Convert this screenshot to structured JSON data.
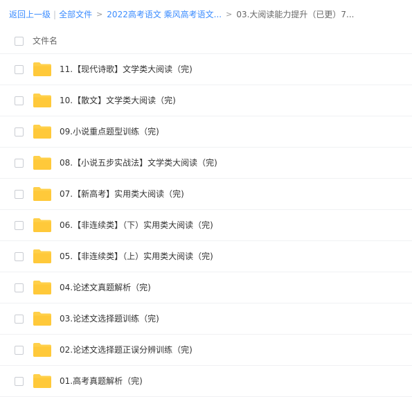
{
  "breadcrumb": {
    "back": "返回上一级",
    "all_files": "全部文件",
    "parent": "2022高考语文 乘风高考语文...",
    "current": "03.大阅读能力提升（已更）7..."
  },
  "list_header": {
    "label": "文件名"
  },
  "icons": {
    "folder": "folder-icon",
    "folder_color": "#ffd04a"
  },
  "files": [
    "11.【现代诗歌】文学类大阅读（完)",
    "10.【散文】文学类大阅读（完)",
    "09.小说重点题型训练（完)",
    "08.【小说五步实战法】文学类大阅读（完)",
    "07.【新高考】实用类大阅读（完)",
    "06.【非连续类】（下）实用类大阅读（完)",
    "05.【非连续类】（上）实用类大阅读（完)",
    "04.论述文真题解析（完)",
    "03.论述文选择题训练（完)",
    "02.论述文选择题正误分辨训练（完)",
    "01.高考真题解析（完)"
  ]
}
